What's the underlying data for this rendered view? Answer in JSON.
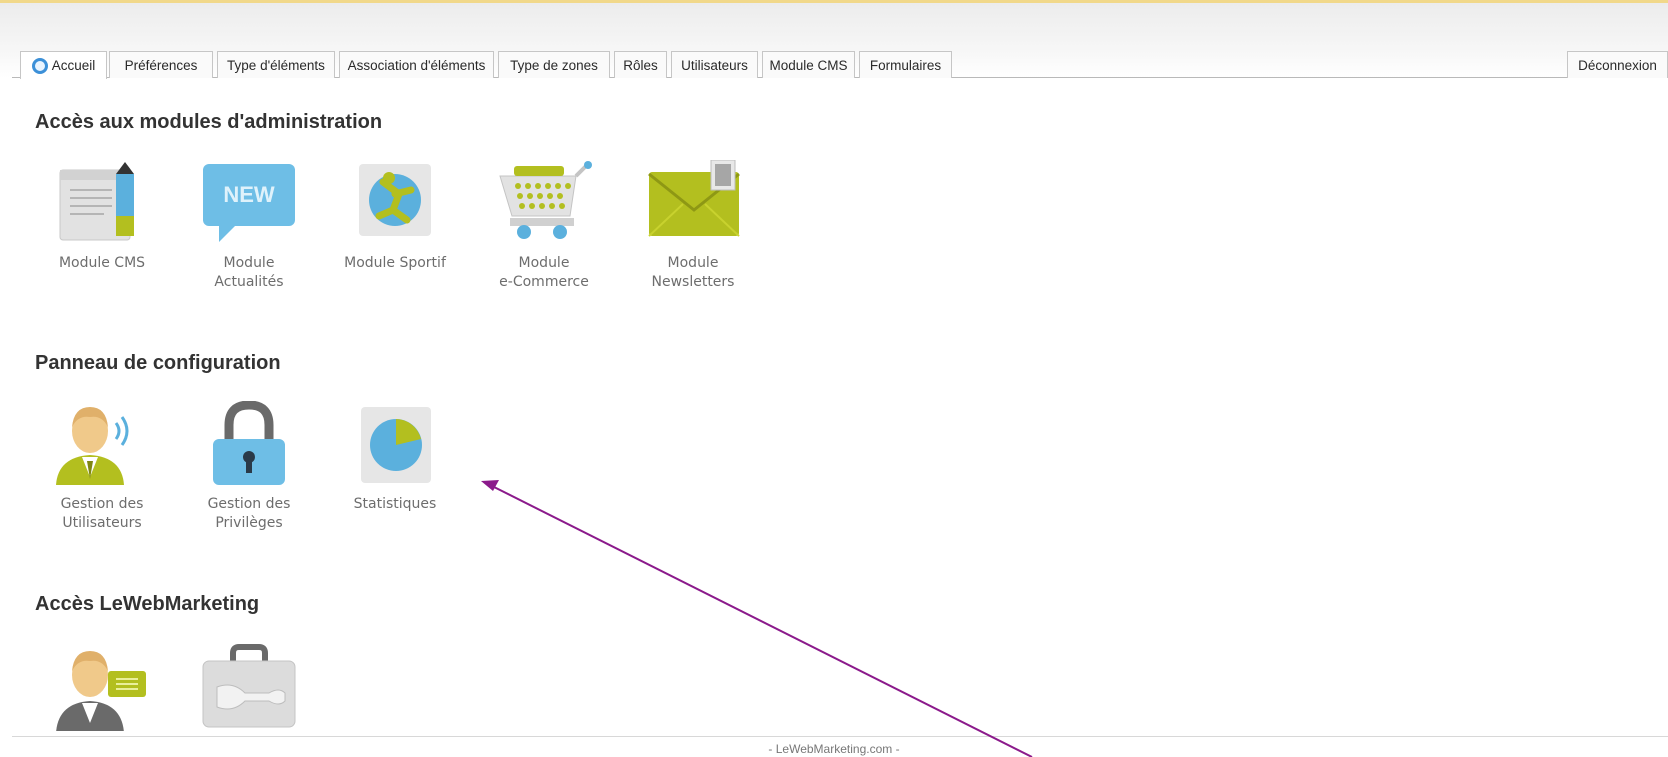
{
  "tabs": [
    {
      "label": "Accueil",
      "active": true,
      "icon": "globe-icon"
    },
    {
      "label": "Préférences"
    },
    {
      "label": "Type d'éléments"
    },
    {
      "label": "Association d'éléments"
    },
    {
      "label": "Type de zones"
    },
    {
      "label": "Rôles"
    },
    {
      "label": "Utilisateurs"
    },
    {
      "label": "Module CMS"
    },
    {
      "label": "Formulaires"
    }
  ],
  "logout_label": "Déconnexion",
  "sections": {
    "admin": {
      "title": "Accès aux modules d'administration",
      "modules": [
        {
          "line1": "Module CMS",
          "line2": "",
          "icon": "cms-document-pencil-icon"
        },
        {
          "line1": "Module",
          "line2": "Actualités",
          "icon": "news-new-icon"
        },
        {
          "line1": "Module Sportif",
          "line2": "",
          "icon": "sport-globe-icon"
        },
        {
          "line1": "Module",
          "line2": "e-Commerce",
          "icon": "shopping-cart-icon"
        },
        {
          "line1": "Module",
          "line2": "Newsletters",
          "icon": "newsletter-envelope-icon"
        }
      ]
    },
    "config": {
      "title": "Panneau de configuration",
      "modules": [
        {
          "line1": "Gestion des",
          "line2": "Utilisateurs",
          "icon": "user-management-icon"
        },
        {
          "line1": "Gestion des",
          "line2": "Privilèges",
          "icon": "padlock-icon"
        },
        {
          "line1": "Statistiques",
          "line2": "",
          "icon": "pie-chart-icon"
        }
      ]
    },
    "lwm": {
      "title": "Accès LeWebMarketing",
      "modules": [
        {
          "icon": "user-message-icon"
        },
        {
          "icon": "toolbox-wrench-icon"
        }
      ]
    }
  },
  "footer": "- LeWebMarketing.com -",
  "colors": {
    "accent_blue": "#5bb0dd",
    "accent_green": "#b3bf1f",
    "annotation_arrow": "#8b1a8b",
    "top_border": "#f1d88a"
  }
}
